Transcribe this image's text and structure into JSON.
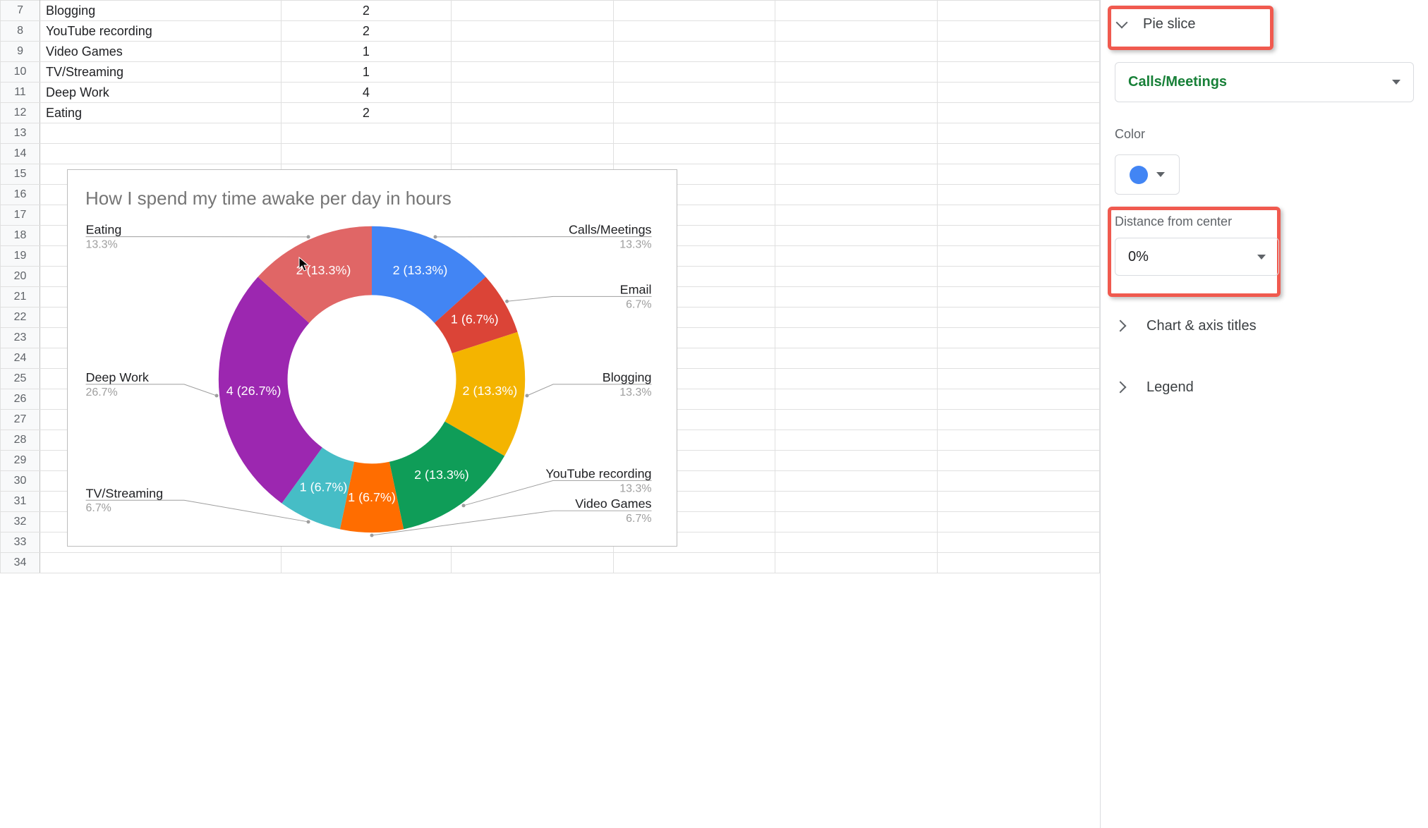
{
  "spreadsheet": {
    "first_row_number": 7,
    "row_count": 28,
    "rows": [
      {
        "a": "Blogging",
        "b": "2"
      },
      {
        "a": "YouTube recording",
        "b": "2"
      },
      {
        "a": "Video Games",
        "b": "1"
      },
      {
        "a": "TV/Streaming",
        "b": "1"
      },
      {
        "a": "Deep Work",
        "b": "4"
      },
      {
        "a": "Eating",
        "b": "2"
      }
    ]
  },
  "chart_data": {
    "type": "pie",
    "donut": true,
    "donut_hole_ratio": 0.55,
    "title": "How I spend my time awake per day in hours",
    "series": [
      {
        "name": "Calls/Meetings",
        "value": 2,
        "percent": 13.3,
        "color": "#4285f4"
      },
      {
        "name": "Email",
        "value": 1,
        "percent": 6.7,
        "color": "#db4437"
      },
      {
        "name": "Blogging",
        "value": 2,
        "percent": 13.3,
        "color": "#f4b400"
      },
      {
        "name": "YouTube recording",
        "value": 2,
        "percent": 13.3,
        "color": "#0f9d58"
      },
      {
        "name": "Video Games",
        "value": 1,
        "percent": 6.7,
        "color": "#ff6d00"
      },
      {
        "name": "TV/Streaming",
        "value": 1,
        "percent": 6.7,
        "color": "#46bdc6"
      },
      {
        "name": "Deep Work",
        "value": 4,
        "percent": 26.7,
        "color": "#9c27b0"
      },
      {
        "name": "Eating",
        "value": 2,
        "percent": 13.3,
        "color": "#e06666"
      }
    ],
    "total": 15,
    "labels": {
      "category_side": [
        {
          "name": "Eating",
          "pct": "13.3%",
          "side": "left"
        },
        {
          "name": "Deep Work",
          "pct": "26.7%",
          "side": "left"
        },
        {
          "name": "TV/Streaming",
          "pct": "6.7%",
          "side": "left"
        },
        {
          "name": "Calls/Meetings",
          "pct": "13.3%",
          "side": "right"
        },
        {
          "name": "Email",
          "pct": "6.7%",
          "side": "right"
        },
        {
          "name": "Blogging",
          "pct": "13.3%",
          "side": "right"
        },
        {
          "name": "YouTube recording",
          "pct": "13.3%",
          "side": "right"
        },
        {
          "name": "Video Games",
          "pct": "6.7%",
          "side": "right"
        }
      ]
    }
  },
  "side_panel": {
    "section_title": "Pie slice",
    "slice_selector_value": "Calls/Meetings",
    "color_label": "Color",
    "slice_color": "#4285f4",
    "distance_label": "Distance from center",
    "distance_value": "0%",
    "collapsed_sections": [
      "Chart & axis titles",
      "Legend"
    ]
  }
}
